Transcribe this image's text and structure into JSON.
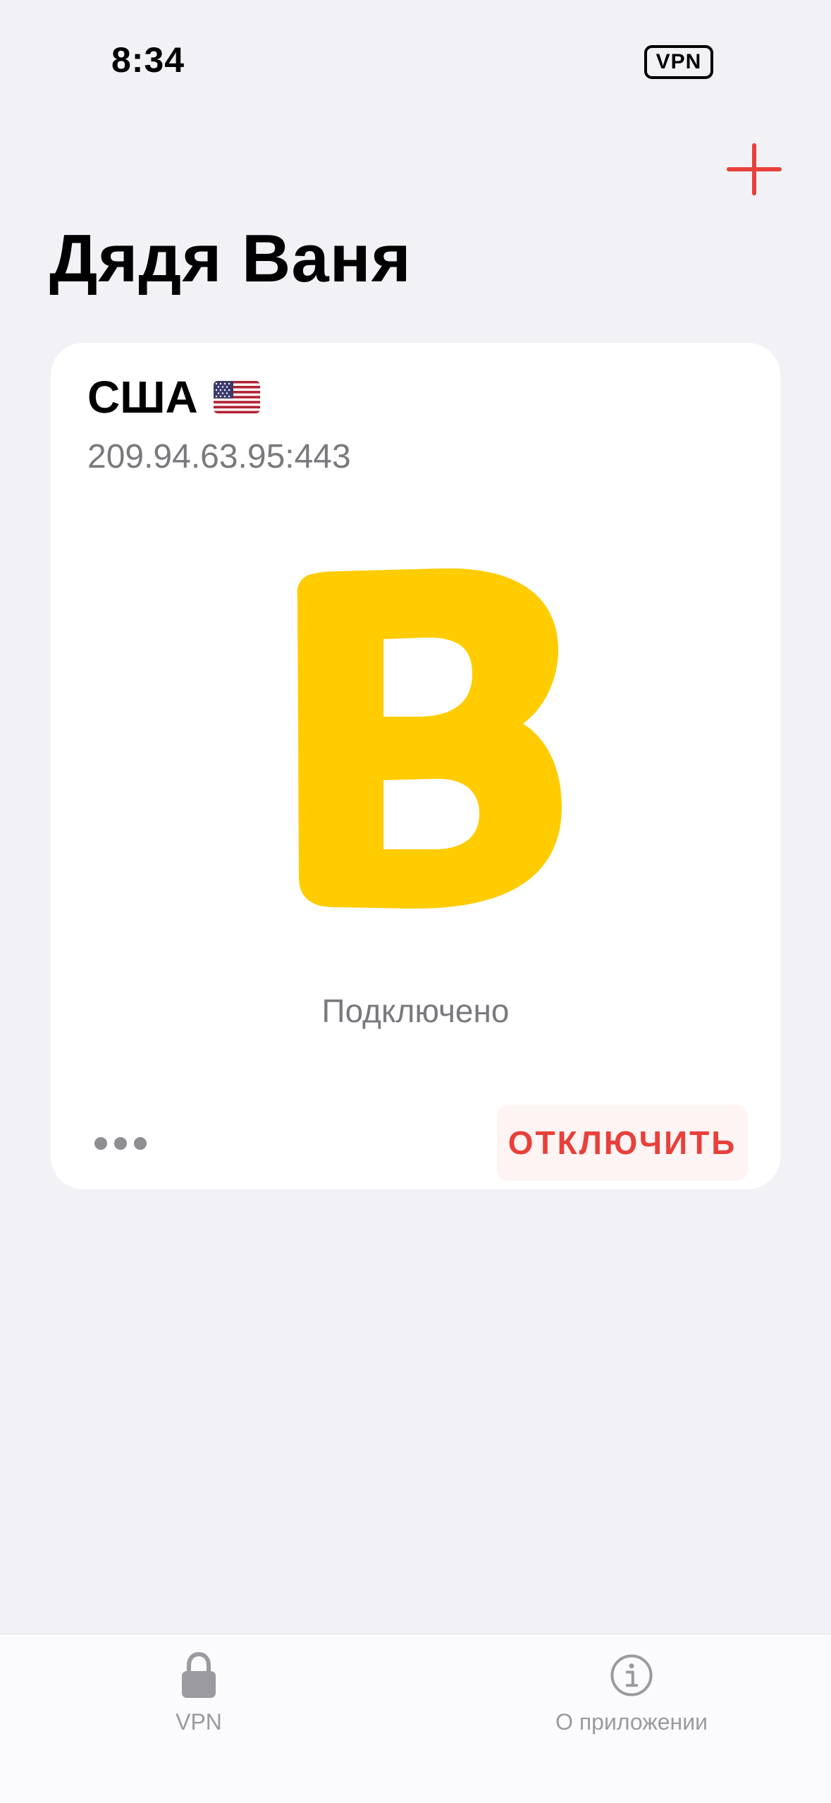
{
  "status_bar": {
    "time": "8:34",
    "vpn_badge": "VPN"
  },
  "header": {
    "title": "Дядя Ваня",
    "add_icon": "plus-icon"
  },
  "server_card": {
    "name": "США",
    "flag": "us-flag-icon",
    "address": "209.94.63.95:443",
    "logo": "b-logo-icon",
    "status": "Подключено",
    "more_icon": "ellipsis-icon",
    "disconnect_label": "ОТКЛЮЧИТЬ"
  },
  "tab_bar": {
    "tabs": [
      {
        "label": "VPN",
        "icon": "lock-icon"
      },
      {
        "label": "О приложении",
        "icon": "info-icon"
      }
    ]
  },
  "colors": {
    "accent": "#e8403a",
    "logo_yellow": "#ffcc00",
    "background": "#f2f1f6",
    "secondary_text": "#7a7a7e"
  }
}
